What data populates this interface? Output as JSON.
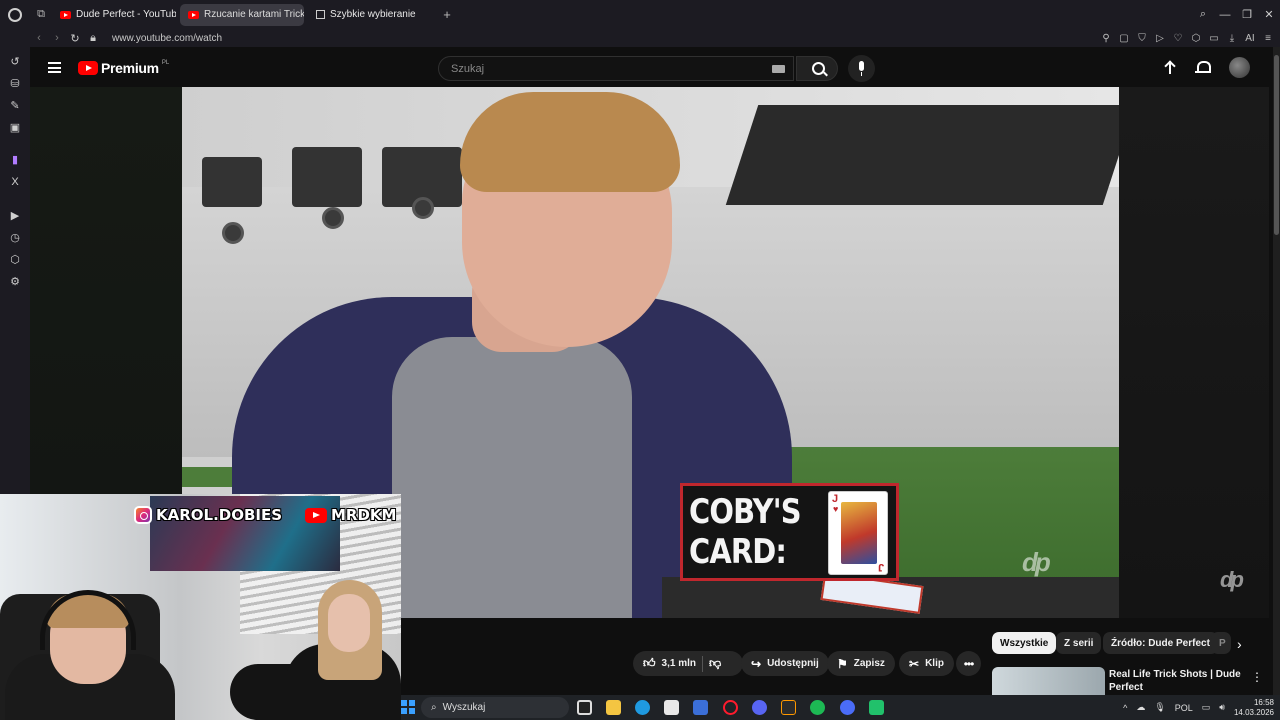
{
  "browser": {
    "tabs": [
      {
        "label": "Dude Perfect - YouTube",
        "active": false,
        "favicon": "youtube-icon"
      },
      {
        "label": "Rzucanie kartami Trick",
        "active": true,
        "favicon": "youtube-icon"
      },
      {
        "label": "Szybkie wybieranie",
        "active": false,
        "favicon": "grid-icon"
      }
    ],
    "url": "www.youtube.com/watch",
    "addr_ai_label": "AI"
  },
  "youtube": {
    "logo_text": "Premium",
    "logo_region": "PL",
    "search_placeholder": "Szukaj"
  },
  "video": {
    "overlay_title_line1": "COBY'S",
    "overlay_title_line2": "CARD:",
    "card_rank": "J",
    "card_suit": "♥",
    "watermark": "dp"
  },
  "webcam": {
    "instagram_handle": "KAROL.DOBIES",
    "youtube_handle": "MRDKM"
  },
  "actions": {
    "like_count": "3,1 mln",
    "share_label": "Udostępnij",
    "save_label": "Zapisz",
    "clip_label": "Klip"
  },
  "chips": [
    "Wszystkie",
    "Z serii",
    "Źródło: Dude Perfect",
    "P"
  ],
  "recommended": {
    "title": "Real Life Trick Shots | Dude Perfect"
  },
  "taskbar": {
    "search_label": "Wyszukaj",
    "language": "POL",
    "time": "16:58",
    "date": "14.03.2026"
  },
  "colors": {
    "youtube_red": "#ff0000",
    "overlay_border": "#c0272d",
    "background": "#0f0f0f"
  }
}
